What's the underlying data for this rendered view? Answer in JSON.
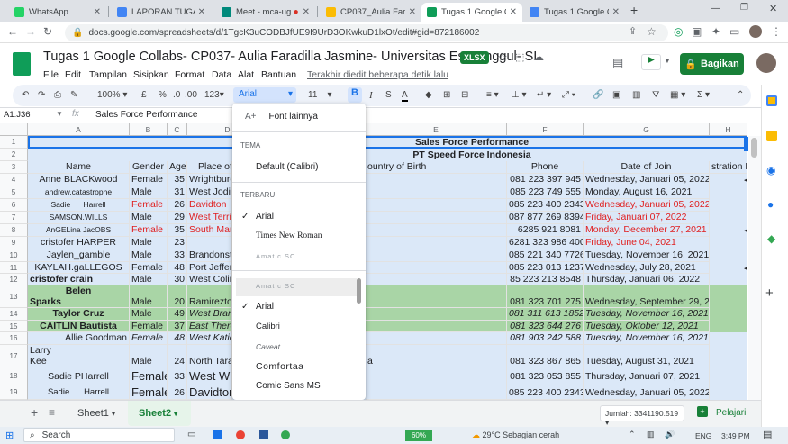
{
  "browser": {
    "tabs": [
      {
        "title": "WhatsApp",
        "color": "#25d366"
      },
      {
        "title": "LAPORAN TUGAS (",
        "color": "#4285f4"
      },
      {
        "title": "Meet - mca-ug",
        "color": "#00897b"
      },
      {
        "title": "CP037_Aulia Faradi",
        "color": "#fbbc04"
      },
      {
        "title": "Tugas 1 Google Co",
        "color": "#0f9d58"
      },
      {
        "title": "Tugas 1 Google Co",
        "color": "#4285f4"
      }
    ],
    "url": "docs.google.com/spreadsheets/d/1TgcK3uCODBJfUE9I9UrD3OKwkuD1lxOt/edit#gid=872186002"
  },
  "doc": {
    "title": "Tugas 1 Google Collabs- CP037- Aulia Faradilla Jasmine- Universitas Esa Unggul- SI",
    "badge": "XLSX",
    "menus": [
      "File",
      "Edit",
      "Tampilan",
      "Sisipkan",
      "Format",
      "Data",
      "Alat",
      "Bantuan"
    ],
    "last_edit": "Terakhir diedit beberapa detik lalu",
    "share": "Bagikan"
  },
  "toolbar": {
    "zoom": "100%",
    "currency": "£",
    "percent": "%",
    "dec1": ".0",
    "dec2": ".00",
    "format": "123",
    "font": "Arial",
    "size": "11",
    "bold": "B",
    "italic": "I",
    "strike": "S",
    "text_color": "A"
  },
  "formula": {
    "name_box": "A1:J36",
    "fx": "fx",
    "content": "Sales Force Performance"
  },
  "grid": {
    "columns": [
      "A",
      "B",
      "C",
      "D",
      "E",
      "F",
      "G",
      "H"
    ],
    "rows": [
      "1",
      "2",
      "3",
      "4",
      "5",
      "6",
      "7",
      "8",
      "9",
      "10",
      "11",
      "12",
      "13",
      "14",
      "15",
      "16",
      "17",
      "18",
      "19"
    ],
    "title": "Sales Force Performance",
    "subtitle": "PT Speed Force Indonesia",
    "headers": {
      "name": "Name",
      "gender": "Gender",
      "age": "Age",
      "place": "Place of",
      "country": "ountry of Birth",
      "phone": "Phone",
      "join": "Date of Join",
      "dur": "stration D"
    },
    "data": [
      {
        "name": "Anne BLACKwood",
        "gender": "Female",
        "age": "35",
        "place": "Wrightburg",
        "e": "",
        "phone": "081 223 397 945",
        "join": "Wednesday, Januari 05, 2022"
      },
      {
        "name": "andrew.catastrophe",
        "gender": "Male",
        "age": "31",
        "place": "West Jodi",
        "e": "",
        "phone": "085 223 749 555",
        "join": "Monday, August 16, 2021"
      },
      {
        "name": "Sadie      Harrell",
        "gender": "Female",
        "age": "26",
        "place": "Davidton",
        "e": "",
        "phone": "085 223 400 2343",
        "join": "Wednesday, Januari 05, 2022"
      },
      {
        "name": "SAMSON.WILLS",
        "gender": "Male",
        "age": "29",
        "place": "West Terrif",
        "e": "",
        "phone": "087 877 269 8394",
        "join": "Friday, Januari 07, 2022"
      },
      {
        "name": "AnGELina JacOBS",
        "gender": "Female",
        "age": "35",
        "place": "South Man",
        "e": "",
        "phone": "6285 921 8081",
        "join": "Monday, December 27, 2021"
      },
      {
        "name": "cristofer HARPER",
        "gender": "Male",
        "age": "23",
        "place": "",
        "e": "",
        "phone": "6281 323 986 400",
        "join": "Friday, June 04, 2021"
      },
      {
        "name": "Jaylen_gamble",
        "gender": "Male",
        "age": "33",
        "place": "Brandonsta",
        "e": "",
        "phone": "085 221 340 7726",
        "join": "Tuesday, November 16, 2021"
      },
      {
        "name": "KAYLAH.gaLLEGOS",
        "gender": "Female",
        "age": "48",
        "place": "Port Jeffery",
        "e": "",
        "phone": "085 223 013 1237",
        "join": "Wednesday, July 28, 2021"
      },
      {
        "name": "cristofer crain",
        "gender": "Male",
        "age": "30",
        "place": "West Colin",
        "e": "",
        "phone": "85 223 213 8548",
        "join": "Thursday, Januari 06, 2022"
      },
      {
        "name": "Belen",
        "name2": "Sparks",
        "gender": "Male",
        "age": "20",
        "place": "Ramireztor",
        "e": "",
        "phone": "081 323 701 275",
        "join": "Wednesday, September 29, 20"
      },
      {
        "name": "Taylor Cruz",
        "gender": "Male",
        "age": "49",
        "place": "West Branc",
        "e": "",
        "phone": "081 311 613 1852",
        "join": "Tuesday, November 16, 2021"
      },
      {
        "name": "CAITLIN Bautista",
        "gender": "Female",
        "age": "37",
        "place": "East There",
        "e": "",
        "phone": "081 323 644 276",
        "join": "Tuesday, Oktober 12, 2021"
      },
      {
        "name": "Allie Goodman",
        "gender": "Female",
        "age": "48",
        "place": "West Katie",
        "e": "",
        "phone": "081 903 242 588",
        "join": "Tuesday, November 16, 2021"
      },
      {
        "name": "Larry",
        "name2": "Kee",
        "gender": "Male",
        "age": "24",
        "place": "North Tara",
        "e": "a",
        "phone": "081 323 867 865",
        "join": "Tuesday, August 31, 2021"
      },
      {
        "name": "Sadie PHarrell",
        "gender": "Female",
        "age": "33",
        "place": "West Wil",
        "e": "",
        "phone": "081 323 053 855",
        "join": "Thursday, Januari 07, 2021"
      },
      {
        "name": "Sadie      Harrell",
        "gender": "Female",
        "age": "26",
        "place": "Davidton",
        "e": "",
        "phone": "085 223 400 2343",
        "join": "Wednesday, Januari 05, 2022"
      }
    ]
  },
  "dropdown": {
    "more_fonts": "Font lainnya",
    "theme_label": "TEMA",
    "theme_default": "Default (Calibri)",
    "recent_label": "TERBARU",
    "recent": [
      "Arial",
      "Times New Roman",
      "Amatic SC"
    ],
    "fonts": [
      "Amatic SC",
      "Arial",
      "Calibri",
      "Caveat",
      "Comfortaa",
      "Comic Sans MS"
    ]
  },
  "sheets": {
    "tabs": [
      "Sheet1",
      "Sheet2"
    ],
    "active": "Sheet2",
    "sum": "Jumlah: 3341190.519",
    "learn": "Pelajari"
  },
  "taskbar": {
    "search": "Search",
    "battery": "60%",
    "weather": "29°C  Sebagian cerah",
    "lang": "ENG",
    "time": "3:49 PM"
  }
}
